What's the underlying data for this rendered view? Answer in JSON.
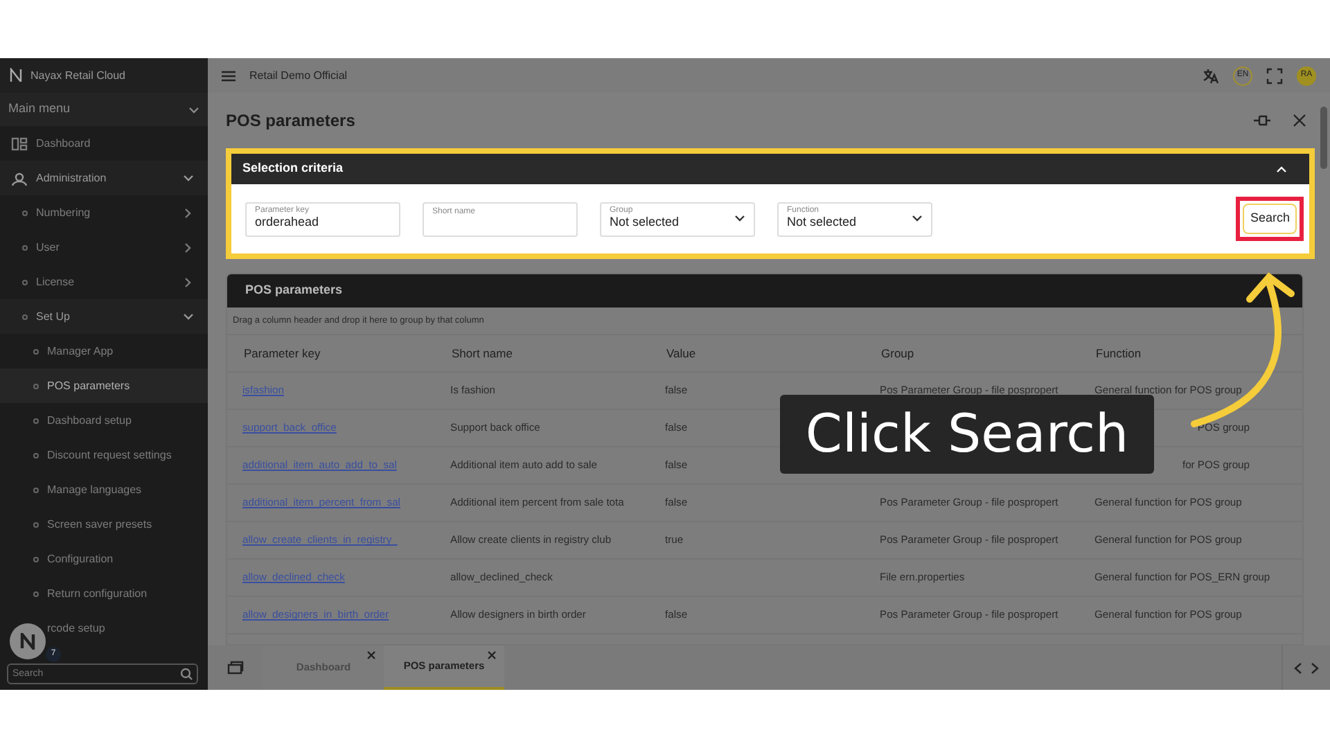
{
  "sidebar": {
    "brand": "Nayax Retail Cloud",
    "menu_title": "Main menu",
    "items": [
      {
        "label": "Dashboard",
        "selected": false
      },
      {
        "label": "Administration",
        "selected": false,
        "expanded": true,
        "children": [
          {
            "label": "Numbering",
            "selected": false,
            "expanded": false
          },
          {
            "label": "User",
            "selected": false,
            "expanded": false
          },
          {
            "label": "License",
            "selected": false,
            "expanded": false
          },
          {
            "label": "Set Up",
            "selected": false,
            "expanded": true,
            "children": [
              {
                "label": "Manager App",
                "selected": false
              },
              {
                "label": "POS parameters",
                "selected": true
              },
              {
                "label": "Dashboard setup",
                "selected": false
              },
              {
                "label": "Discount request settings",
                "selected": false
              },
              {
                "label": "Manage languages",
                "selected": false
              },
              {
                "label": "Screen saver presets",
                "selected": false
              },
              {
                "label": "Configuration",
                "selected": false
              },
              {
                "label": "Return configuration",
                "selected": false
              },
              {
                "label": "rcode setup",
                "selected": false
              }
            ]
          }
        ]
      }
    ],
    "help_count": "7",
    "search": {
      "placeholder": "Search"
    }
  },
  "topbar": {
    "company": "Retail Demo Official",
    "language": "EN",
    "avatar": "RA"
  },
  "page": {
    "title": "POS parameters"
  },
  "criteria": {
    "title": "Selection criteria",
    "fields": [
      {
        "kind": "text",
        "label": "Parameter key",
        "value": "orderahead"
      },
      {
        "kind": "text",
        "label": "Short name"
      },
      {
        "kind": "select",
        "label": "Group",
        "value": "Not selected"
      },
      {
        "kind": "select",
        "label": "Function",
        "value": "Not selected"
      }
    ],
    "button": "Search"
  },
  "grid": {
    "title": "POS parameters",
    "group_hint": "Drag a column header and drop it here to group by that column",
    "columns": [
      "Parameter key",
      "Short name",
      "Value",
      "Group",
      "Function"
    ],
    "rows": [
      {
        "parameter_key": "isfashion",
        "short_name": "Is fashion",
        "value": "false",
        "group": "Pos Parameter Group - file pospropert",
        "function": "General function for POS group"
      },
      {
        "parameter_key": "support_back_office",
        "short_name": "Support back office",
        "value": "false",
        "kind": "covered",
        "function": "POS group"
      },
      {
        "parameter_key": "additional_item_auto_add_to_sal",
        "short_name": "Additional item auto add to sale",
        "value": "false",
        "kind": "covered",
        "function": "for POS group"
      },
      {
        "parameter_key": "additional_item_percent_from_sal",
        "short_name": "Additional item percent from sale tota",
        "value": "false",
        "group": "Pos Parameter Group - file pospropert",
        "function": "General function for POS group"
      },
      {
        "parameter_key": "allow_create_clients_in_registry_",
        "short_name": "Allow create clients in registry club",
        "value": "true",
        "group": "Pos Parameter Group - file pospropert",
        "function": "General function for POS group"
      },
      {
        "parameter_key": "allow_declined_check",
        "short_name": "allow_declined_check",
        "group": "File ern.properties",
        "function": "General function for POS_ERN group"
      },
      {
        "parameter_key": "allow_designers_in_birth_order",
        "short_name": "Allow designers in birth order",
        "value": "false",
        "group": "Pos Parameter Group - file pospropert",
        "function": "General function for POS group"
      }
    ]
  },
  "tabs": [
    {
      "label": "Dashboard",
      "selected": false
    },
    {
      "label": "POS parameters",
      "selected": true
    }
  ],
  "callout": {
    "text": "Click Search"
  }
}
